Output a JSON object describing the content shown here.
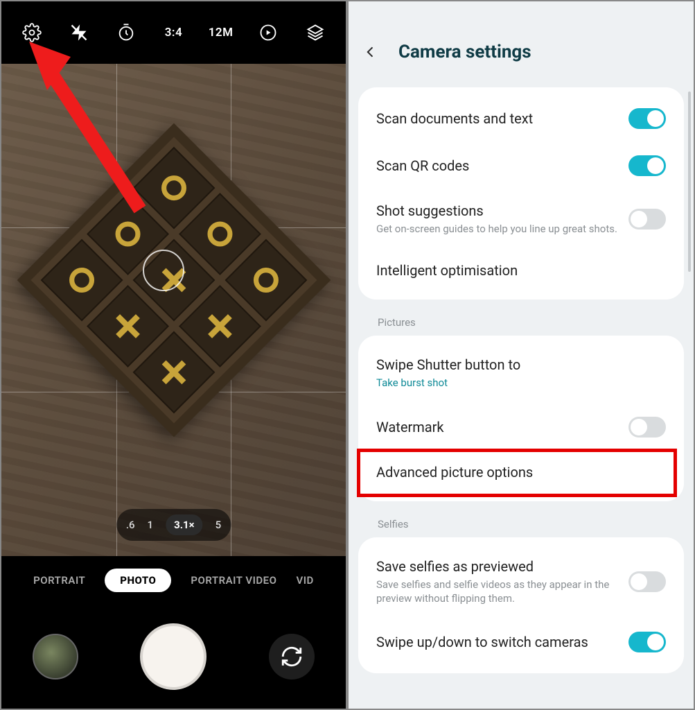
{
  "camera": {
    "top": {
      "aspect": "3:4",
      "megapixels": "12M"
    },
    "zoom": {
      "options": [
        ".6",
        "1",
        "3.1×",
        "5"
      ],
      "selected": "3.1×"
    },
    "modes": [
      "PORTRAIT",
      "PHOTO",
      "PORTRAIT VIDEO",
      "VID"
    ],
    "selected_mode": "PHOTO"
  },
  "settings": {
    "title": "Camera settings",
    "sections": {
      "general": [
        {
          "title": "Scan documents and text",
          "toggle": true
        },
        {
          "title": "Scan QR codes",
          "toggle": true
        },
        {
          "title": "Shot suggestions",
          "sub": "Get on-screen guides to help you line up great shots.",
          "toggle": false
        },
        {
          "title": "Intelligent optimisation"
        }
      ],
      "pictures_label": "Pictures",
      "pictures": [
        {
          "title": "Swipe Shutter button to",
          "sub_teal": "Take burst shot"
        },
        {
          "title": "Watermark",
          "toggle": false
        },
        {
          "title": "Advanced picture options"
        }
      ],
      "selfies_label": "Selfies",
      "selfies": [
        {
          "title": "Save selfies as previewed",
          "sub": "Save selfies and selfie videos as they appear in the preview without flipping them.",
          "toggle": false
        },
        {
          "title": "Swipe up/down to switch cameras",
          "toggle": true
        }
      ]
    }
  }
}
